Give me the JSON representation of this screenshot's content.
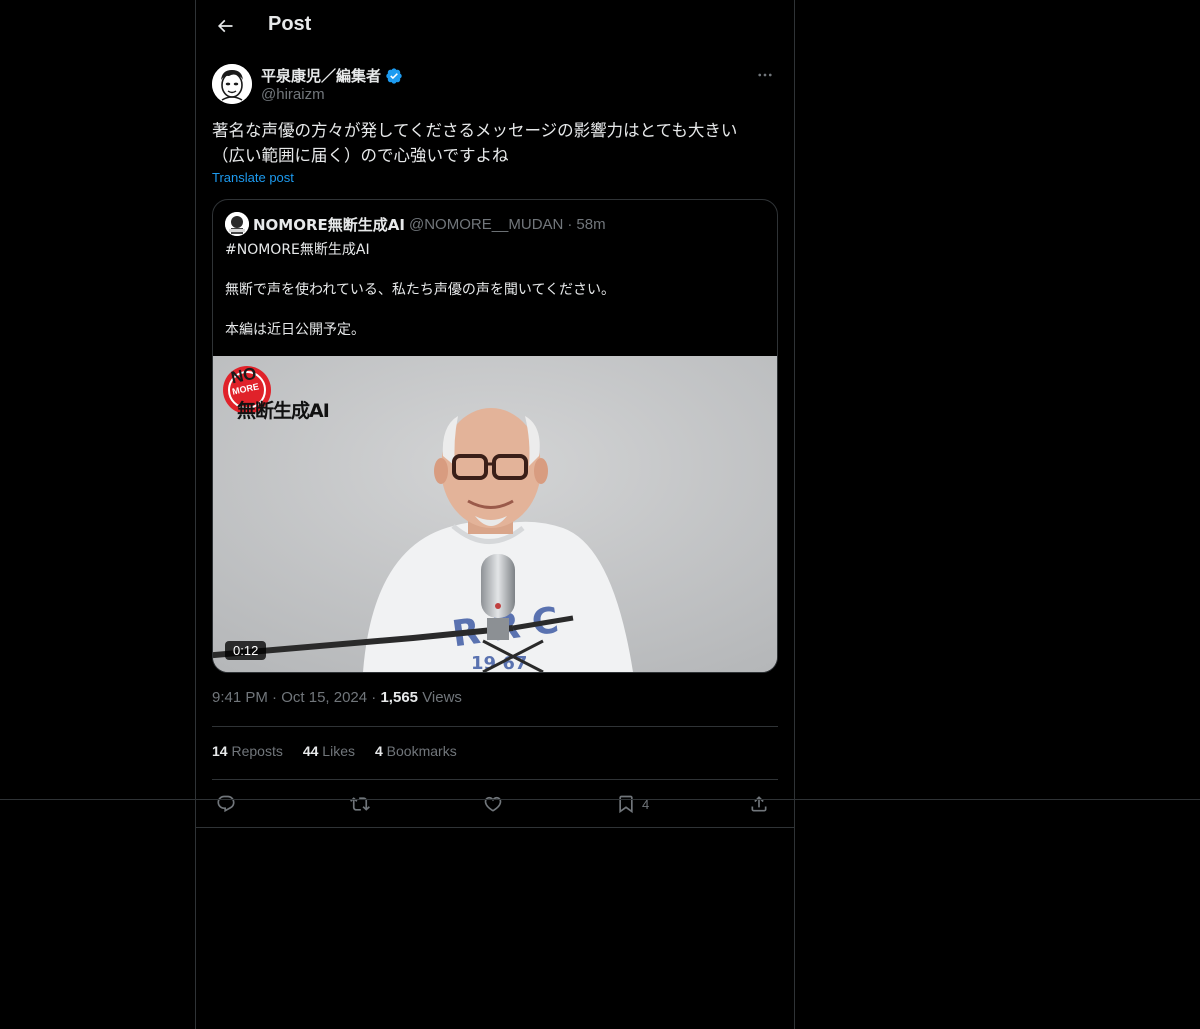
{
  "header": {
    "title": "Post",
    "back_icon": "arrow-left-icon"
  },
  "post": {
    "author_name": "平泉康児／編集者",
    "author_handle": "@hiraizm",
    "verified_color": "#1d9bf0",
    "more_icon": "ellipsis-icon",
    "text_lines": [
      "著名な声優の方々が発してくださるメッセージの影響力はとても大きい",
      "（広い範囲に届く）ので心強いですよね"
    ],
    "translate_label": "Translate post"
  },
  "quote": {
    "name": "NOMORE無断生成AI",
    "handle": "@NOMORE__MUDAN",
    "separator": "·",
    "time": "58m",
    "paragraphs": [
      "#NOMORE無断生成AI",
      "無断で声を使われている、私たち声優の声を聞いてください。",
      "本編は近日公開予定。"
    ],
    "video": {
      "logo_no": "NO",
      "logo_more": "MORE",
      "logo_text": "無断生成AI",
      "duration": "0:12"
    }
  },
  "meta": {
    "time": "9:41 PM",
    "dot": "·",
    "date": "Oct 15, 2024",
    "views_count": "1,565",
    "views_label": "Views"
  },
  "stats": [
    {
      "count": "14",
      "label": "Reposts"
    },
    {
      "count": "44",
      "label": "Likes"
    },
    {
      "count": "4",
      "label": "Bookmarks"
    }
  ],
  "actions": {
    "reply_icon": "reply-icon",
    "repost_icon": "repost-icon",
    "like_icon": "heart-icon",
    "bookmark_icon": "bookmark-icon",
    "bookmark_count": "4",
    "share_icon": "share-icon"
  },
  "colors": {
    "background": "#000000",
    "text": "#e7e9ea",
    "muted": "#71767b",
    "border": "#2f3336",
    "accent": "#1d9bf0"
  }
}
